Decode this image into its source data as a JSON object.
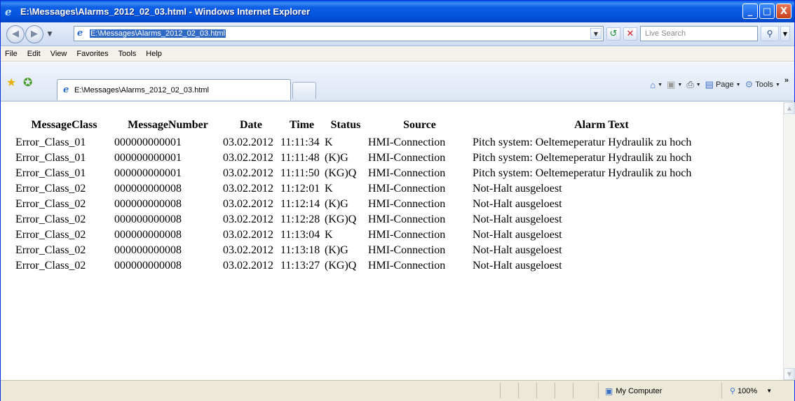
{
  "window": {
    "title": "E:\\Messages\\Alarms_2012_02_03.html - Windows Internet Explorer",
    "minimize": "_",
    "maximize": "□",
    "close": "X"
  },
  "address": {
    "url": "E:\\Messages\\Alarms_2012_02_03.html",
    "search_placeholder": "Live Search"
  },
  "menu": [
    "File",
    "Edit",
    "View",
    "Favorites",
    "Tools",
    "Help"
  ],
  "tab": {
    "title": "E:\\Messages\\Alarms_2012_02_03.html"
  },
  "commands": {
    "page": "Page",
    "tools": "Tools"
  },
  "table": {
    "headers": [
      "MessageClass",
      "MessageNumber",
      "Date",
      "Time",
      "Status",
      "Source",
      "Alarm Text"
    ],
    "rows": [
      [
        "Error_Class_01",
        "000000000001",
        "03.02.2012",
        "11:11:34",
        "K",
        "HMI-Connection",
        "Pitch system: Oeltemeperatur Hydraulik zu hoch"
      ],
      [
        "Error_Class_01",
        "000000000001",
        "03.02.2012",
        "11:11:48",
        "(K)G",
        "HMI-Connection",
        "Pitch system: Oeltemeperatur Hydraulik zu hoch"
      ],
      [
        "Error_Class_01",
        "000000000001",
        "03.02.2012",
        "11:11:50",
        "(KG)Q",
        "HMI-Connection",
        "Pitch system: Oeltemeperatur Hydraulik zu hoch"
      ],
      [
        "Error_Class_02",
        "000000000008",
        "03.02.2012",
        "11:12:01",
        "K",
        "HMI-Connection",
        "Not-Halt ausgeloest"
      ],
      [
        "Error_Class_02",
        "000000000008",
        "03.02.2012",
        "11:12:14",
        "(K)G",
        "HMI-Connection",
        "Not-Halt ausgeloest"
      ],
      [
        "Error_Class_02",
        "000000000008",
        "03.02.2012",
        "11:12:28",
        "(KG)Q",
        "HMI-Connection",
        "Not-Halt ausgeloest"
      ],
      [
        "Error_Class_02",
        "000000000008",
        "03.02.2012",
        "11:13:04",
        "K",
        "HMI-Connection",
        "Not-Halt ausgeloest"
      ],
      [
        "Error_Class_02",
        "000000000008",
        "03.02.2012",
        "11:13:18",
        "(K)G",
        "HMI-Connection",
        "Not-Halt ausgeloest"
      ],
      [
        "Error_Class_02",
        "000000000008",
        "03.02.2012",
        "11:13:27",
        "(KG)Q",
        "HMI-Connection",
        "Not-Halt ausgeloest"
      ]
    ]
  },
  "status": {
    "zone": "My Computer",
    "zoom": "100%"
  },
  "icons": {
    "back": "back-arrow-icon",
    "forward": "forward-arrow-icon",
    "refresh": "refresh-icon",
    "stop": "stop-icon",
    "search": "search-icon",
    "favorites": "favorites-star-icon",
    "add_favorite": "add-favorite-icon",
    "home": "home-icon",
    "feeds": "feeds-icon",
    "print": "print-icon",
    "page": "page-icon",
    "tools": "tools-gear-icon",
    "computer": "computer-icon",
    "zoom": "zoom-icon"
  }
}
